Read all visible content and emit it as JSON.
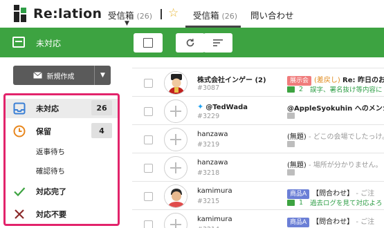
{
  "header": {
    "logo_text": "Re:lation",
    "tabs": [
      {
        "label": "受信箱",
        "count": "(26)"
      },
      {
        "label": "受信箱",
        "count": "(26)"
      },
      {
        "label": "問い合わせ"
      }
    ]
  },
  "toolbar": {
    "title": "未対応",
    "accent_color": "#3da341"
  },
  "sidebar": {
    "compose_label": "新規作成",
    "highlight_color": "#e2236b",
    "items": [
      {
        "label": "未対応",
        "count": "26",
        "icon": "inbox-icon"
      },
      {
        "label": "保留",
        "count": "4",
        "icon": "clock-icon"
      },
      {
        "label": "返事待ち"
      },
      {
        "label": "確認待ち"
      },
      {
        "label": "対応完了",
        "icon": "check-icon"
      },
      {
        "label": "対応不要",
        "icon": "cross-icon"
      }
    ]
  },
  "messages": [
    {
      "sender": "株式会社インゲー (2)",
      "ticket": "#3087",
      "tag": "展示会",
      "tag_color": "#f07c7c",
      "status": "(差戻し)",
      "subject": "Re: 昨日のお",
      "comment_count": "2",
      "snippet": "誤字、署名抜け等内容に",
      "avatar": "photo-red"
    },
    {
      "sender": "@TedWada",
      "ticket": "#3229",
      "subject": "@AppleSyokuhin へのメンシ",
      "avatar": "plus"
    },
    {
      "sender": "hanzawa",
      "ticket": "#3219",
      "subject_prefix": "(無題)",
      "subject": " - どこの会場でしたっけ。",
      "avatar": "plus"
    },
    {
      "sender": "hanzawa",
      "ticket": "#3218",
      "subject_prefix": "(無題)",
      "subject": " - 場所が分かりません。",
      "avatar": "plus"
    },
    {
      "sender": "kamimura",
      "ticket": "#3215",
      "tag": "商品A",
      "tag_color": "#6b7fd6",
      "subject_prefix": "【問合わせ】",
      "subject": " - ご注",
      "comment_count": "1",
      "snippet": "過去ログを見て対応よろ",
      "avatar": "photo-man"
    },
    {
      "sender": "kamimura",
      "ticket": "#3214",
      "tag": "商品A",
      "tag_color": "#6b7fd6",
      "subject_prefix": "【問合わせ】",
      "subject": " - ご注",
      "avatar": "plus"
    }
  ]
}
